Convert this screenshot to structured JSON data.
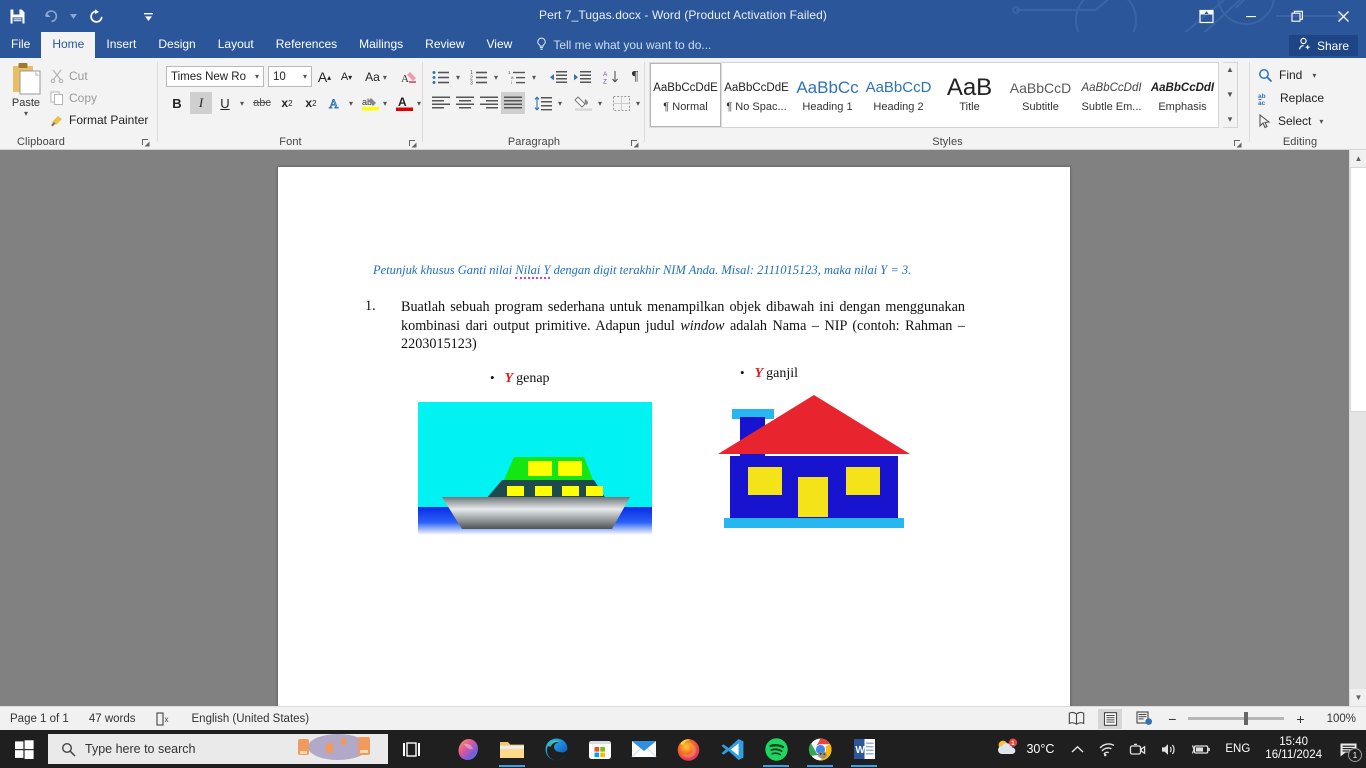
{
  "window": {
    "title": "Pert 7_Tugas.docx - Word (Product Activation Failed)",
    "accent_color": "#2b579a",
    "quick_access": [
      {
        "name": "save-icon",
        "label": "Save"
      },
      {
        "name": "undo-icon",
        "label": "Undo"
      },
      {
        "name": "redo-icon",
        "label": "Redo"
      },
      {
        "name": "customize-qat-icon",
        "label": "Customize Quick Access Toolbar"
      }
    ],
    "controls": [
      {
        "name": "ribbon-display-options",
        "label": "Ribbon Display Options"
      },
      {
        "name": "minimize",
        "label": "Minimize"
      },
      {
        "name": "restore",
        "label": "Restore Down"
      },
      {
        "name": "close",
        "label": "Close"
      }
    ]
  },
  "tabs": [
    {
      "label": "File",
      "active": false
    },
    {
      "label": "Home",
      "active": true
    },
    {
      "label": "Insert",
      "active": false
    },
    {
      "label": "Design",
      "active": false
    },
    {
      "label": "Layout",
      "active": false
    },
    {
      "label": "References",
      "active": false
    },
    {
      "label": "Mailings",
      "active": false
    },
    {
      "label": "Review",
      "active": false
    },
    {
      "label": "View",
      "active": false
    }
  ],
  "tellme": {
    "placeholder": "Tell me what you want to do..."
  },
  "share": {
    "label": "Share"
  },
  "ribbon": {
    "clipboard": {
      "group_label": "Clipboard",
      "paste_label": "Paste",
      "cut_label": "Cut",
      "copy_label": "Copy",
      "format_painter_label": "Format Painter"
    },
    "font": {
      "group_label": "Font",
      "font_name": "Times New Ro",
      "font_size": "10",
      "buttons": [
        "Grow Font",
        "Shrink Font",
        "Change Case",
        "Clear Formatting",
        "Bold",
        "Italic",
        "Underline",
        "Strikethrough",
        "Subscript",
        "Superscript",
        "Text Effects",
        "Text Highlight Color",
        "Font Color"
      ],
      "bold_label": "B",
      "italic_label": "I",
      "underline_label": "U",
      "strike_label": "abc",
      "sub_label": "x",
      "sup_label": "x",
      "case_label": "Aa",
      "grow_label": "A",
      "shrink_label": "A",
      "texteffects_label": "A",
      "fontcolor_label": "A",
      "highlight_label": "ab"
    },
    "paragraph": {
      "group_label": "Paragraph",
      "buttons": [
        "Bullets",
        "Numbering",
        "Multilevel List",
        "Decrease Indent",
        "Increase Indent",
        "Sort",
        "Show/Hide",
        "Align Left",
        "Center",
        "Align Right",
        "Justify",
        "Line and Paragraph Spacing",
        "Shading",
        "Borders"
      ],
      "pilcrow": "¶"
    },
    "styles": {
      "group_label": "Styles",
      "items": [
        {
          "preview": "AaBbCcDdE",
          "name": "¶ Normal",
          "selected": true,
          "color": "#222222",
          "italic": false,
          "size": 11.5
        },
        {
          "preview": "AaBbCcDdE",
          "name": "¶ No Spac...",
          "selected": false,
          "color": "#222222",
          "italic": false,
          "size": 11.5
        },
        {
          "preview": "AaBbCc",
          "name": "Heading 1",
          "selected": false,
          "color": "#2e74b5",
          "italic": false,
          "size": 17
        },
        {
          "preview": "AaBbCcD",
          "name": "Heading 2",
          "selected": false,
          "color": "#2e74b5",
          "italic": false,
          "size": 15
        },
        {
          "preview": "AaB",
          "name": "Title",
          "selected": false,
          "color": "#222222",
          "italic": false,
          "size": 24
        },
        {
          "preview": "AaBbCcD",
          "name": "Subtitle",
          "selected": false,
          "color": "#5a5a5a",
          "italic": false,
          "size": 14
        },
        {
          "preview": "AaBbCcDdI",
          "name": "Subtle Em...",
          "selected": false,
          "color": "#444444",
          "italic": true,
          "size": 11.5
        },
        {
          "preview": "AaBbCcDdI",
          "name": "Emphasis",
          "selected": false,
          "color": "#222222",
          "italic": true,
          "size": 11.5
        }
      ]
    },
    "editing": {
      "group_label": "Editing",
      "find_label": "Find",
      "replace_label": "Replace",
      "select_label": "Select"
    }
  },
  "document": {
    "instruction": {
      "prefix": "Petunjuk khusus Ganti nilai ",
      "underlined": "Nilai  Y",
      "suffix": " dengan digit terakhir NIM Anda. Misal: 2111015123, maka nilai Y = 3.",
      "color": "#1f6fc4"
    },
    "item_number": "1.",
    "paragraph_part1": "Buatlah sebuah program sederhana untuk menampilkan objek dibawah ini dengan menggunakan kombinasi dari output primitive. Adapun judul ",
    "paragraph_italic": "window",
    "paragraph_part2": " adalah Nama – NIP (contoh: Rahman – 2203015123)",
    "bullet_left": {
      "marker": "•",
      "variable": "Y",
      "text": "genap"
    },
    "bullet_right": {
      "marker": "•",
      "variable": "Y",
      "text": "ganjil"
    },
    "image_boat": {
      "name": "boat-illustration",
      "sky_color": "#00f2f2",
      "sea_color": "#0d2fe0",
      "hull_color": "#8a8f91",
      "deck_color": "#1d4a4a",
      "cabin_color": "#13e613",
      "window_color": "#ffff00"
    },
    "image_house": {
      "name": "house-illustration",
      "roof_color": "#e8252f",
      "wall_color": "#1713cf",
      "window_color": "#f5e31a",
      "door_color": "#f5e31a",
      "trim_color": "#27b6f0",
      "background_color": "#ffffff"
    }
  },
  "statusbar": {
    "page": "Page 1 of 1",
    "words": "47 words",
    "proofing_icon": "spelling-check-icon",
    "language": "English (United States)",
    "views": [
      {
        "name": "read-mode-icon",
        "active": false
      },
      {
        "name": "print-layout-icon",
        "active": true
      },
      {
        "name": "web-layout-icon",
        "active": false
      }
    ],
    "zoom_out": "−",
    "zoom_in": "+",
    "zoom_level": "100%"
  },
  "taskbar": {
    "start": {
      "name": "windows-start-icon"
    },
    "search": {
      "placeholder": "Type here to search"
    },
    "task_view": {
      "name": "task-view-icon"
    },
    "apps": [
      {
        "name": "copilot-icon",
        "label": "Copilot",
        "running": false
      },
      {
        "name": "file-explorer-icon",
        "label": "File Explorer",
        "running": true
      },
      {
        "name": "edge-icon",
        "label": "Microsoft Edge",
        "running": false
      },
      {
        "name": "microsoft-store-icon",
        "label": "Microsoft Store",
        "running": false
      },
      {
        "name": "mail-icon",
        "label": "Mail",
        "running": false
      },
      {
        "name": "firefox-icon",
        "label": "Mozilla Firefox",
        "running": false
      },
      {
        "name": "vscode-icon",
        "label": "Visual Studio Code",
        "running": false
      },
      {
        "name": "spotify-icon",
        "label": "Spotify",
        "running": true
      },
      {
        "name": "chrome-icon",
        "label": "Google Chrome",
        "running": true
      },
      {
        "name": "word-icon",
        "label": "Microsoft Word",
        "running": true
      }
    ],
    "tray": {
      "weather_temp": "30°C",
      "show_hidden": "∧",
      "icons": [
        "wifi-icon",
        "camera-icon",
        "volume-icon",
        "battery-icon"
      ],
      "language": "ENG",
      "time": "15:40",
      "date": "16/11/2024",
      "notification_count": "1"
    }
  }
}
